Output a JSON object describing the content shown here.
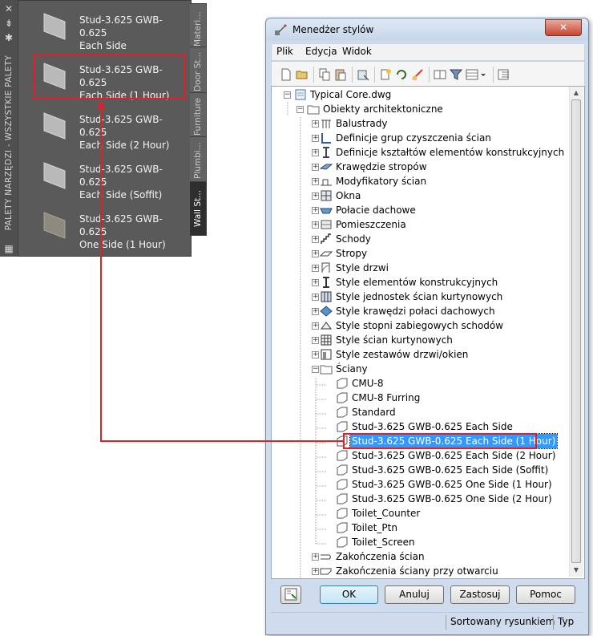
{
  "palette": {
    "vertical_title": "PALETY NARZĘDZI - WSZYSTKIE PALETY",
    "tools": [
      {
        "line1": "Stud-3.625 GWB-0.625",
        "line2": "Each Side"
      },
      {
        "line1": "Stud-3.625 GWB-0.625",
        "line2": "Each Side (1 Hour)"
      },
      {
        "line1": "Stud-3.625 GWB-0.625",
        "line2": "Each Side (2 Hour)"
      },
      {
        "line1": "Stud-3.625 GWB-0.625",
        "line2": "Each Side (Soffit)"
      },
      {
        "line1": "Stud-3.625 GWB-0.625",
        "line2": "One Side (1 Hour)"
      }
    ],
    "tabs": [
      "Materi...",
      "Door St...",
      "Furniture",
      "Plumbi...",
      "Wall St..."
    ]
  },
  "window": {
    "title": "Menedżer stylów",
    "menu": [
      "Plik",
      "Edycja",
      "Widok"
    ],
    "tree": {
      "root": "Typical Core.dwg",
      "group": "Obiekty architektoniczne",
      "categories": [
        "Balustrady",
        "Definicje grup czyszczenia ścian",
        "Definicje kształtów elementów konstrukcyjnych",
        "Krawędzie stropów",
        "Modyfikatory ścian",
        "Okna",
        "Połacie dachowe",
        "Pomieszczenia",
        "Schody",
        "Stropy",
        "Style drzwi",
        "Style elementów konstrukcyjnych",
        "Style jednostek ścian kurtynowych",
        "Style krawędzi połaci dachowych",
        "Style stopni zabiegowych schodów",
        "Style ścian kurtynowych",
        "Style zestawów drzwi/okien"
      ],
      "walls_label": "Ściany",
      "walls": [
        "CMU-8",
        "CMU-8 Furring",
        "Standard",
        "Stud-3.625 GWB-0.625 Each Side",
        "Stud-3.625 GWB-0.625 Each Side (1 Hour)",
        "Stud-3.625 GWB-0.625 Each Side (2 Hour)",
        "Stud-3.625 GWB-0.625 Each Side (Soffit)",
        "Stud-3.625 GWB-0.625 One Side (1 Hour)",
        "Stud-3.625 GWB-0.625 One Side (2 Hour)",
        "Toilet_Counter",
        "Toilet_Ptn",
        "Toilet_Screen"
      ],
      "after": [
        "Zakończenia ścian",
        "Zakończenia ściany przy otwarciu"
      ]
    },
    "buttons": {
      "ok": "OK",
      "cancel": "Anuluj",
      "apply": "Zastosuj",
      "help": "Pomoc"
    },
    "status": {
      "sort": "Sortowany rysunkiem",
      "type": "Typ"
    }
  },
  "colors": {
    "callout": "#e0202a",
    "selection": "#3399ff"
  }
}
